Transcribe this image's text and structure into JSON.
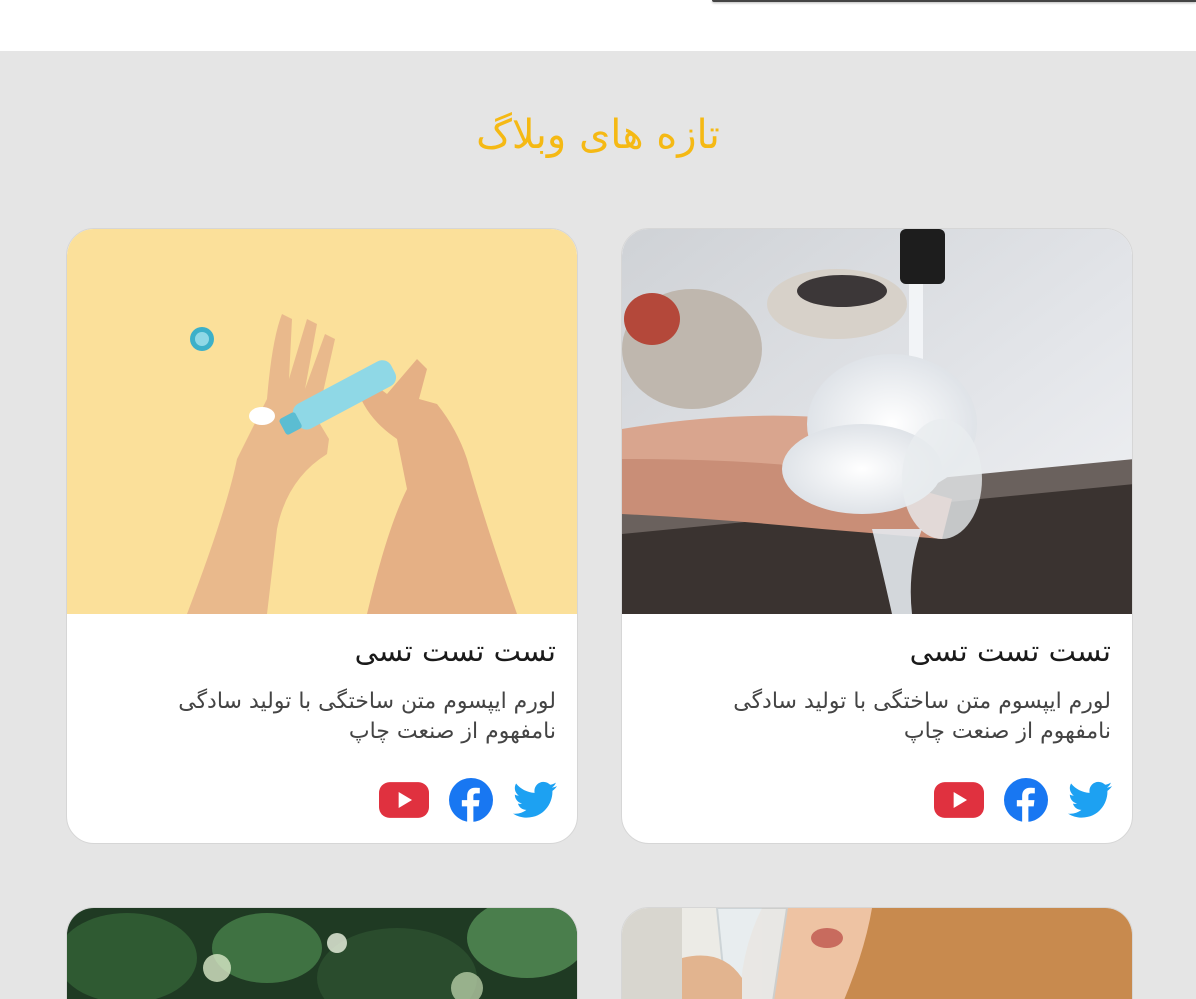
{
  "section": {
    "title": "تازه های وبلاگ"
  },
  "cards": [
    {
      "title": "تست تست تسی",
      "excerpt": "لورم ایپسوم متن ساختگی با تولید سادگی نامفهوم از صنعت چاپ",
      "image": "hands-washing-with-soap-photo",
      "socials": [
        "twitter-icon",
        "facebook-icon",
        "youtube-icon"
      ]
    },
    {
      "title": "تست تست تسی",
      "excerpt": "لورم ایپسوم متن ساختگی با تولید سادگی نامفهوم از صنعت چاپ",
      "image": "hand-cream-on-yellow-background-photo",
      "socials": [
        "twitter-icon",
        "facebook-icon",
        "youtube-icon"
      ]
    },
    {
      "image": "woman-drinking-water-photo"
    },
    {
      "image": "trees-bokeh-photo"
    }
  ],
  "colors": {
    "accent": "#f5b914",
    "twitter": "#1da1f2",
    "facebook": "#1877f2",
    "youtube": "#e0313f",
    "background": "#e5e5e5"
  }
}
